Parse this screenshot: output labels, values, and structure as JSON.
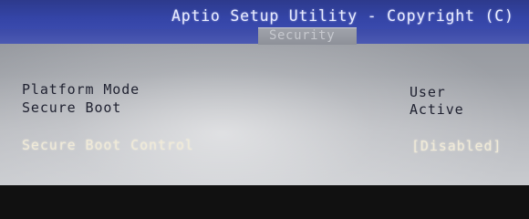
{
  "title_bar": {
    "title": "Aptio Setup Utility - Copyright (C)"
  },
  "tabs": {
    "active": "Security"
  },
  "settings": {
    "platform_mode": {
      "label": "Platform Mode",
      "value": "User"
    },
    "secure_boot": {
      "label": "Secure Boot",
      "value": "Active"
    },
    "secure_boot_control": {
      "label": "Secure Boot Control",
      "value": "[Disabled]"
    }
  }
}
